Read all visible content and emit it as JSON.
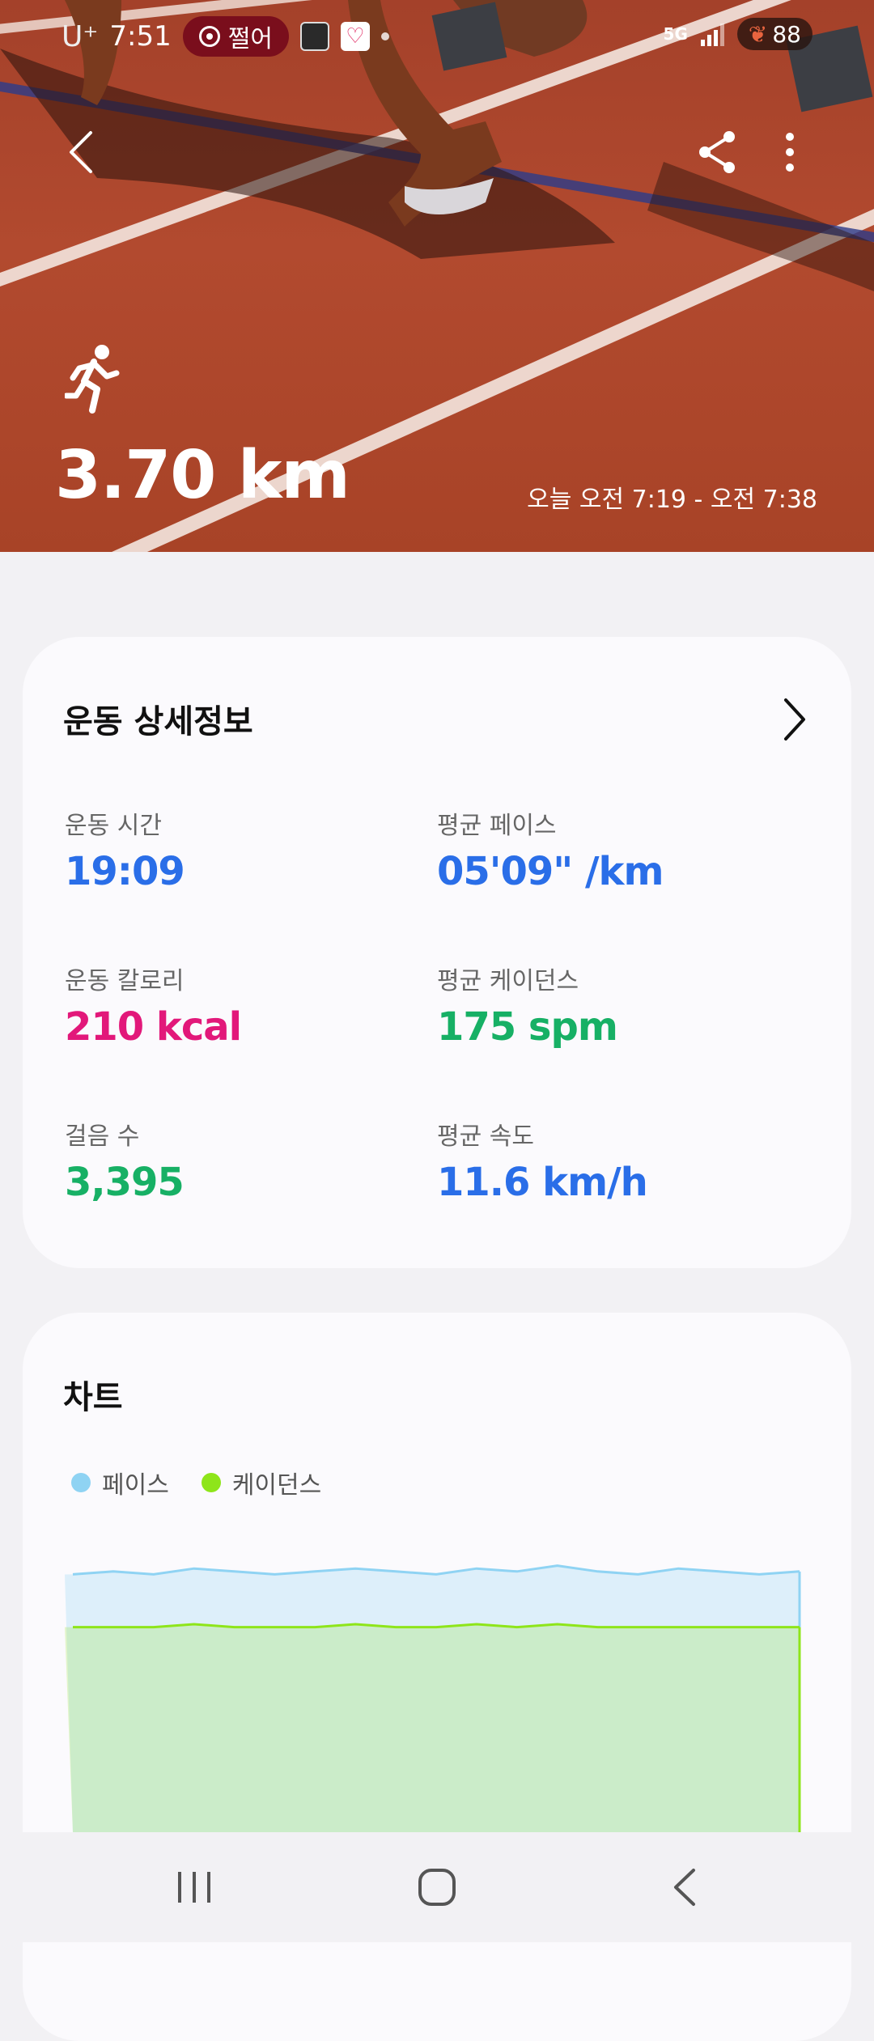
{
  "status_bar": {
    "carrier": "U⁺",
    "time": "7:51",
    "pill_label": "쩔어",
    "network": "5G",
    "battery": "88"
  },
  "hero": {
    "distance": "3.70 km",
    "time_range": "오늘 오전 7:19 - 오전 7:38",
    "icons": [
      "back-icon",
      "share-icon",
      "more-icon",
      "running-icon"
    ]
  },
  "details": {
    "title": "운동 상세정보",
    "metrics": [
      {
        "label": "운동 시간",
        "value": "19:09",
        "color": "#2a6ee8"
      },
      {
        "label": "평균 페이스",
        "value": "05'09\" /km",
        "color": "#2a6ee8"
      },
      {
        "label": "운동 칼로리",
        "value": "210 kcal",
        "color": "#e2187a"
      },
      {
        "label": "평균 케이던스",
        "value": "175 spm",
        "color": "#17b065"
      },
      {
        "label": "걸음 수",
        "value": "3,395",
        "color": "#17b065"
      },
      {
        "label": "평균 속도",
        "value": "11.6 km/h",
        "color": "#2a6ee8"
      }
    ]
  },
  "chart": {
    "title": "차트",
    "legend": [
      {
        "name": "페이스",
        "color": "#8fd3f3"
      },
      {
        "name": "케이던스",
        "color": "#8ee51a"
      }
    ]
  },
  "chart_data": {
    "type": "area",
    "title": "차트",
    "series": [
      {
        "name": "페이스",
        "color": "#8fd3f3",
        "values": [
          0.88,
          0.89,
          0.88,
          0.9,
          0.89,
          0.88,
          0.89,
          0.9,
          0.89,
          0.88,
          0.9,
          0.89,
          0.91,
          0.89,
          0.88,
          0.9,
          0.89,
          0.88,
          0.89
        ]
      },
      {
        "name": "케이던스",
        "color": "#8ee51a",
        "values": [
          0.7,
          0.7,
          0.7,
          0.71,
          0.7,
          0.7,
          0.7,
          0.71,
          0.7,
          0.7,
          0.71,
          0.7,
          0.71,
          0.7,
          0.7,
          0.7,
          0.7,
          0.7,
          0.7
        ]
      }
    ],
    "grid": false,
    "legend_position": "top-left"
  },
  "navbar": {
    "icons": [
      "recent-apps-icon",
      "home-icon",
      "back-icon"
    ]
  }
}
